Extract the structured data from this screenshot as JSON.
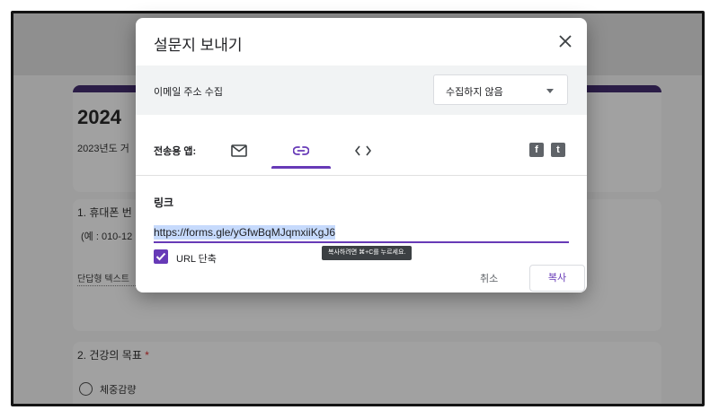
{
  "background": {
    "form_title": "2024",
    "form_description": "2023년도 거",
    "question1": "1. 휴대폰 번",
    "question1_example": "(예 : 010-12",
    "short_answer": "단답형 텍스트",
    "question2": "2. 건강의 목표",
    "question2_required": "*",
    "question2_option1": "체중감량"
  },
  "dialog": {
    "title": "설문지 보내기",
    "collect_email_label": "이메일 주소 수집",
    "collect_email_value": "수집하지 않음",
    "send_via_label": "전송용 앱:",
    "link_heading": "링크",
    "link_url": "https://forms.gle/yGfwBqMJqmxiiKgJ6",
    "shorten_url_label": "URL 단축",
    "tooltip": "복사하려면 ⌘+C를 누르세요.",
    "cancel_label": "취소",
    "copy_label": "복사",
    "social_facebook": "f",
    "social_twitter": "t"
  },
  "colors": {
    "accent": "#673ab7",
    "overlay": "#9c9c9c",
    "selection": "#c6dafc"
  },
  "icons": [
    "close-icon",
    "dropdown-caret-icon",
    "email-icon",
    "link-icon",
    "embed-icon",
    "facebook-icon",
    "twitter-icon",
    "checkmark-icon"
  ]
}
